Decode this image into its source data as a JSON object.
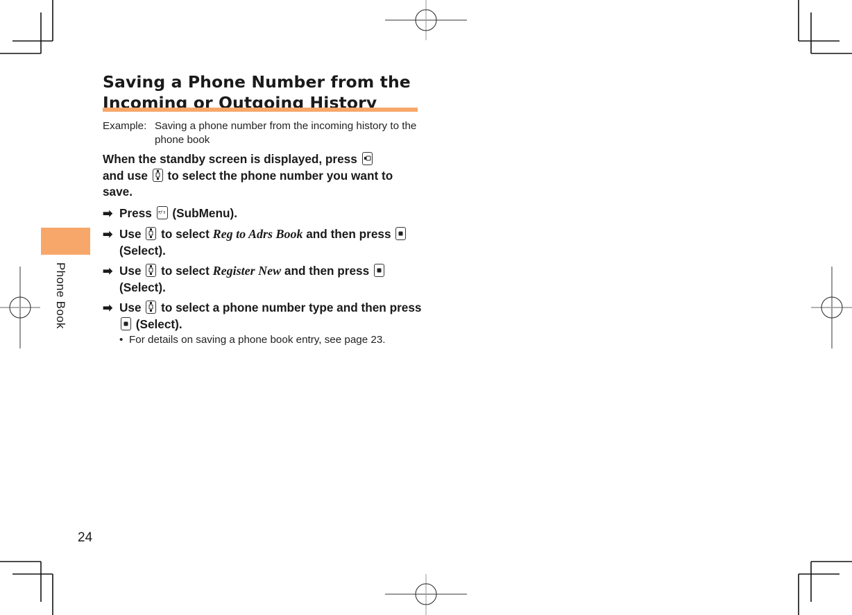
{
  "section": {
    "title_line1": "Saving a Phone Number from the",
    "title_line2": "Incoming or Outgoing History",
    "example_label": "Example:",
    "example_text": "Saving a phone number from the incoming history to the phone book",
    "accent_color": "#F7A76A"
  },
  "lead": {
    "part1": "When the standby screen is displayed, press",
    "part2": "and use",
    "part3": "to select the phone number you want to save.",
    "key1_icon": "incoming-history-key-icon",
    "key2_icon": "navigation-key-icon"
  },
  "steps": [
    {
      "arrow": "➡",
      "p1": "Press",
      "key_icon": "app-key-icon",
      "key_label": "アプリ",
      "p2": "(SubMenu)."
    },
    {
      "arrow": "➡",
      "p1": "Use",
      "key_icon": "navigation-key-icon",
      "p2": "to select",
      "item": "Reg to Adrs Book",
      "p3": "and then press",
      "key2_icon": "center-key-icon",
      "p4": "(Select)."
    },
    {
      "arrow": "➡",
      "p1": "Use",
      "key_icon": "navigation-key-icon",
      "p2": "to select",
      "item": "Register New",
      "p3": "and then press",
      "key2_icon": "center-key-icon",
      "p4": "(Select)."
    },
    {
      "arrow": "➡",
      "p1": "Use",
      "key_icon": "navigation-key-icon",
      "p2": "to select a phone number type and then press",
      "key2_icon": "center-key-icon",
      "p4": "(Select)."
    }
  ],
  "note": {
    "bullet": "•",
    "text": "For details on saving a phone book entry, see page 23."
  },
  "sidebar": {
    "chapter": "Phone Book"
  },
  "footer": {
    "page_number": "24"
  }
}
